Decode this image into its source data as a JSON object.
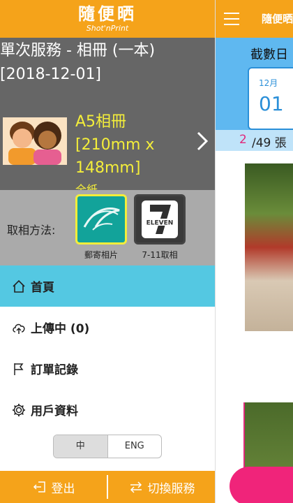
{
  "drawer": {
    "logo_cn": "隨便晒",
    "logo_en": "Shot'nPrint",
    "service_line1": "單次服務 - 相冊 (一本)",
    "service_line2": "[2018-12-01]",
    "product_name": "A5相冊 [210mm x 148mm]",
    "product_sub": "全紙",
    "pickup_label": "取相方法:",
    "pickup_options": [
      {
        "label": "郵寄相片",
        "selected": true
      },
      {
        "label": "7-11取相",
        "selected": false
      }
    ],
    "menu": [
      {
        "label": "首頁",
        "icon": "home-icon",
        "active": true
      },
      {
        "label": "上傳中 (0)",
        "icon": "cloud-upload-icon",
        "active": false
      },
      {
        "label": "訂單記錄",
        "icon": "flag-icon",
        "active": false
      },
      {
        "label": "用戶資料",
        "icon": "gear-icon",
        "active": false
      }
    ],
    "lang_options": [
      "中",
      "ENG"
    ],
    "lang_selected": "中",
    "footer_logout": "登出",
    "footer_switch": "切換服務"
  },
  "background": {
    "title": "隨便晒",
    "cutoff_label": "截數日",
    "cal_month": "12月",
    "cal_day": "01",
    "count_current": "2",
    "count_rest": "/49 張"
  },
  "colors": {
    "accent_orange": "#f5a31a",
    "active_menu": "#54c8e2",
    "product_yellow": "#f4ee3a",
    "count_pink": "#e0287b"
  }
}
